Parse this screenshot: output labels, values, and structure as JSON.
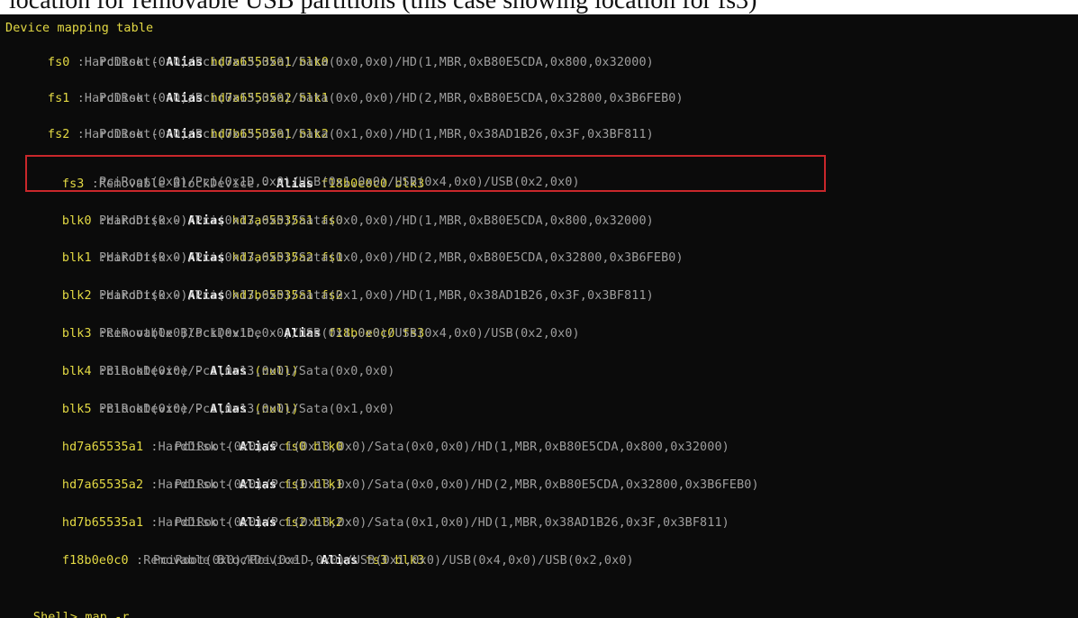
{
  "caption": "location for removable USB partitions (this case showing location for fs3)",
  "terminal": {
    "header": "Device mapping table",
    "entries": [
      {
        "label": "fs0",
        "type": ":HardDisk -",
        "alias_word": "Alias",
        "alias_value": "hd7a65535a1 blk0",
        "path": "PciRoot(0x0)/Pci(0x13,0x0)/Sata(0x0,0x0)/HD(1,MBR,0xB80E5CDA,0x800,0x32000)"
      },
      {
        "label": "fs1",
        "type": ":HardDisk -",
        "alias_word": "Alias",
        "alias_value": "hd7a65535a2 blk1",
        "path": "PciRoot(0x0)/Pci(0x13,0x0)/Sata(0x0,0x0)/HD(2,MBR,0xB80E5CDA,0x32800,0x3B6FEB0)"
      },
      {
        "label": "fs2",
        "type": ":HardDisk -",
        "alias_word": "Alias",
        "alias_value": "hd7b65535a1 blk2",
        "path": "PciRoot(0x0)/Pci(0x13,0x0)/Sata(0x1,0x0)/HD(1,MBR,0x38AD1B26,0x3F,0x3BF811)"
      },
      {
        "label": "fs3",
        "type": ":Removable BlockDevice -",
        "alias_word": "Alias",
        "alias_value": "f18b0e0c0 blk3",
        "path": "PciRoot(0x0)/Pci(0x1D,0x0)/USB(0x1,0x0)/USB(0x4,0x0)/USB(0x2,0x0)"
      },
      {
        "label": "blk0",
        "type": ":HardDisk -",
        "alias_word": "Alias",
        "alias_value": "hd7a65535a1 fs0",
        "path": "PciRoot(0x0)/Pci(0x13,0x0)/Sata(0x0,0x0)/HD(1,MBR,0xB80E5CDA,0x800,0x32000)"
      },
      {
        "label": "blk1",
        "type": ":HardDisk -",
        "alias_word": "Alias",
        "alias_value": "hd7a65535a2 fs1",
        "path": "PciRoot(0x0)/Pci(0x13,0x0)/Sata(0x0,0x0)/HD(2,MBR,0xB80E5CDA,0x32800,0x3B6FEB0)"
      },
      {
        "label": "blk2",
        "type": ":HardDisk -",
        "alias_word": "Alias",
        "alias_value": "hd7b65535a1 fs2",
        "path": "PciRoot(0x0)/Pci(0x13,0x0)/Sata(0x1,0x0)/HD(1,MBR,0x38AD1B26,0x3F,0x3BF811)"
      },
      {
        "label": "blk3",
        "type": ":Removable BlockDevice -",
        "alias_word": "Alias",
        "alias_value": "f18b0e0c0 fs3",
        "path": "PciRoot(0x0)/Pci(0x1D,0x0)/USB(0x1,0x0)/USB(0x4,0x0)/USB(0x2,0x0)"
      },
      {
        "label": "blk4",
        "type": ":BlockDevice -",
        "alias_word": "Alias",
        "alias_value": "(null)",
        "path": "PciRoot(0x0)/Pci(0x13,0x0)/Sata(0x0,0x0)"
      },
      {
        "label": "blk5",
        "type": ":BlockDevice -",
        "alias_word": "Alias",
        "alias_value": "(null)",
        "path": "PciRoot(0x0)/Pci(0x13,0x0)/Sata(0x1,0x0)"
      },
      {
        "label": "hd7a65535a1",
        "type": ":HardDisk -",
        "alias_word": "Alias",
        "alias_value": "fs0 blk0",
        "path": "PciRoot(0x0)/Pci(0x13,0x0)/Sata(0x0,0x0)/HD(1,MBR,0xB80E5CDA,0x800,0x32000)"
      },
      {
        "label": "hd7a65535a2",
        "type": ":HardDisk -",
        "alias_word": "Alias",
        "alias_value": "fs1 blk1",
        "path": "PciRoot(0x0)/Pci(0x13,0x0)/Sata(0x0,0x0)/HD(2,MBR,0xB80E5CDA,0x32800,0x3B6FEB0)"
      },
      {
        "label": "hd7b65535a1",
        "type": ":HardDisk -",
        "alias_word": "Alias",
        "alias_value": "fs2 blk2",
        "path": "PciRoot(0x0)/Pci(0x13,0x0)/Sata(0x1,0x0)/HD(1,MBR,0x38AD1B26,0x3F,0x3BF811)"
      },
      {
        "label": "f18b0e0c0",
        "type": ":Removable BlockDevice -",
        "alias_word": "Alias",
        "alias_value": "fs3 blk3",
        "path": "PciRoot(0x0)/Pci(0x1D,0x0)/USB(0x1,0x0)/USB(0x4,0x0)/USB(0x2,0x0)"
      }
    ],
    "prompt": "Shell> map -r",
    "highlight_color": "#c9272b",
    "label_color": "#e4da44",
    "text_color": "#bdbdbd",
    "background_color": "#0b0b0b"
  }
}
